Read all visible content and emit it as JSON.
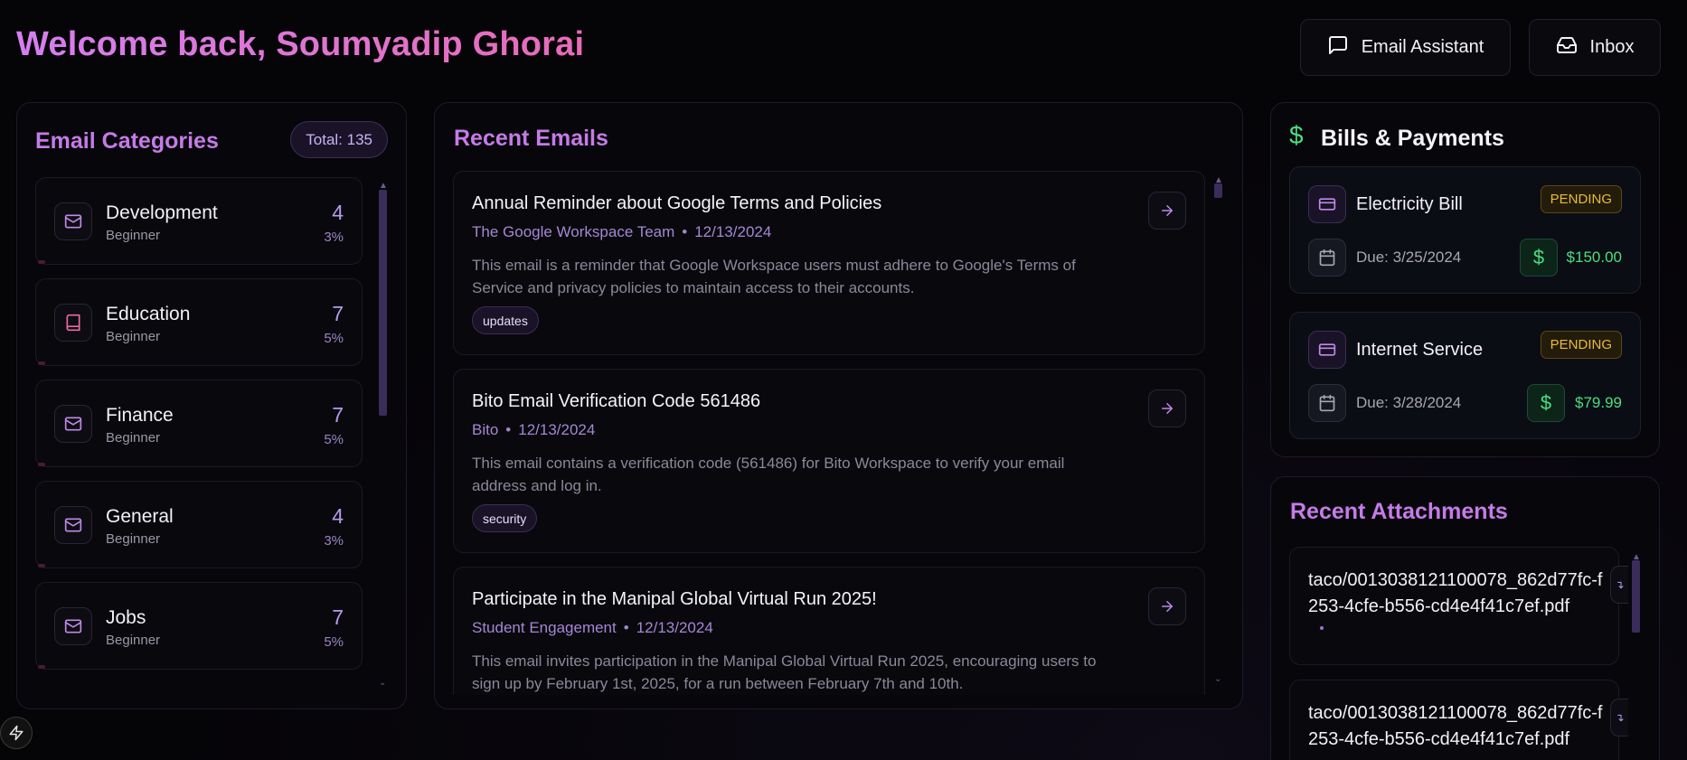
{
  "header": {
    "welcome": "Welcome back, Soumyadip Ghorai",
    "email_assistant_label": "Email Assistant",
    "inbox_label": "Inbox"
  },
  "categories": {
    "title": "Email Categories",
    "total": "Total: 135",
    "items": [
      {
        "name": "Development",
        "level": "Beginner",
        "count": "4",
        "pct": "3%",
        "icon": "mail-icon"
      },
      {
        "name": "Education",
        "level": "Beginner",
        "count": "7",
        "pct": "5%",
        "icon": "book-icon"
      },
      {
        "name": "Finance",
        "level": "Beginner",
        "count": "7",
        "pct": "5%",
        "icon": "mail-icon"
      },
      {
        "name": "General",
        "level": "Beginner",
        "count": "4",
        "pct": "3%",
        "icon": "mail-icon"
      },
      {
        "name": "Jobs",
        "level": "Beginner",
        "count": "7",
        "pct": "5%",
        "icon": "mail-icon"
      }
    ]
  },
  "emails": {
    "title": "Recent Emails",
    "items": [
      {
        "subject": "Annual Reminder about Google Terms and Policies",
        "sender": "The Google Workspace Team",
        "date": "12/13/2024",
        "body": "This email is a reminder that Google Workspace users must adhere to Google's Terms of Service and privacy policies to maintain access to their accounts.",
        "tag": "updates"
      },
      {
        "subject": "Bito Email Verification Code 561486",
        "sender": "Bito",
        "date": "12/13/2024",
        "body": "This email contains a verification code (561486) for Bito Workspace to verify your email address and log in.",
        "tag": "security"
      },
      {
        "subject": "Participate in the Manipal Global Virtual Run 2025!",
        "sender": "Student Engagement",
        "date": "12/13/2024",
        "body": "This email invites participation in the Manipal Global Virtual Run 2025, encouraging users to sign up by February 1st, 2025, for a run between February 7th and 10th.",
        "tag": ""
      }
    ]
  },
  "bills": {
    "title": "Bills & Payments",
    "items": [
      {
        "name": "Electricity Bill",
        "status": "PENDING",
        "due": "Due: 3/25/2024",
        "amount": "$150.00"
      },
      {
        "name": "Internet Service",
        "status": "PENDING",
        "due": "Due: 3/28/2024",
        "amount": "$79.99"
      }
    ]
  },
  "attachments": {
    "title": "Recent Attachments",
    "items": [
      {
        "name": "taco/0013038121100078_862d77fc-f253-4cfe-b556-cd4e4f41c7ef.pdf"
      },
      {
        "name": "taco/0013038121100078_862d77fc-f253-4cfe-b556-cd4e4f41c7ef.pdf"
      }
    ]
  },
  "colors": {
    "accent": "#c57be8",
    "pending": "#e8bb3a",
    "money": "#4ade80"
  }
}
